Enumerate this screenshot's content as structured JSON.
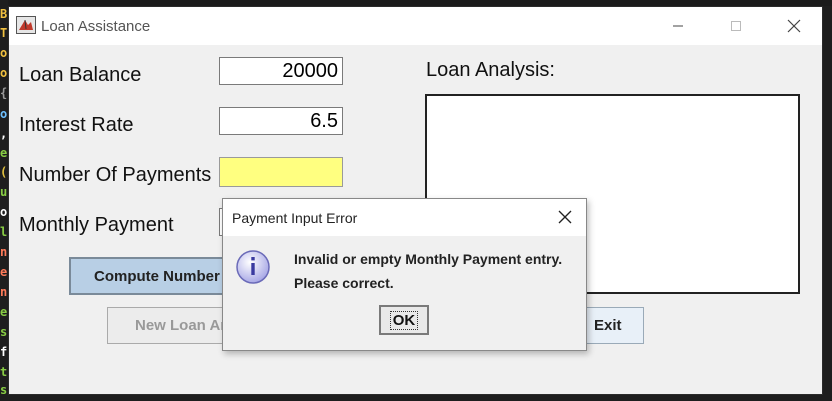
{
  "window": {
    "title": "Loan Assistance"
  },
  "form": {
    "loan_balance_label": "Loan Balance",
    "loan_balance_value": "20000",
    "interest_rate_label": "Interest Rate",
    "interest_rate_value": "6.5",
    "num_payments_label": "Number Of Payments",
    "num_payments_value": "",
    "monthly_payment_label": "Monthly Payment",
    "monthly_payment_value": ""
  },
  "analysis": {
    "label": "Loan Analysis:"
  },
  "buttons": {
    "compute_label": "Compute Number",
    "new_loan_label": "New Loan An",
    "exit_label": "Exit"
  },
  "dialog": {
    "title": "Payment Input Error",
    "message_line1": "Invalid or empty Monthly Payment entry.",
    "message_line2": "Please correct.",
    "ok_label": "OK"
  },
  "colors": {
    "highlight_field": "#ffff80",
    "compute_button": "#b8cfe5",
    "dialog_bg": "#f0f0f0"
  }
}
